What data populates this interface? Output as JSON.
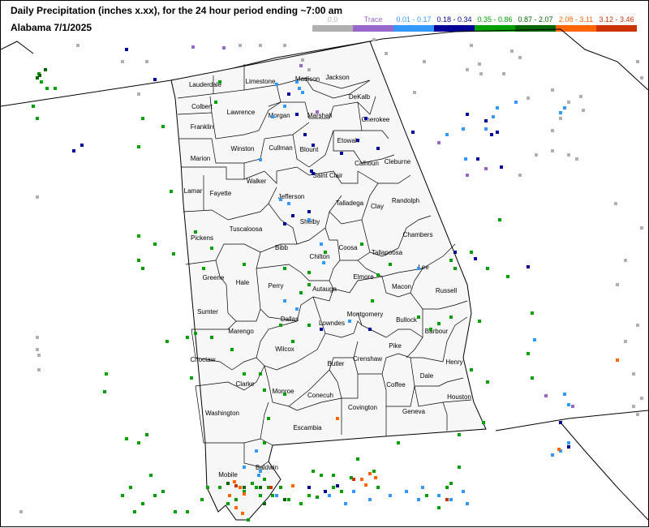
{
  "title": "Daily Precipitation (inches  x.xx),  for the 24 hour period ending ~7:00 am",
  "subtitle": "Alabama 7/1/2025",
  "legend": [
    {
      "label": "0.0",
      "color": "#b0b0b0"
    },
    {
      "label": "Trace",
      "color": "#9966cc"
    },
    {
      "label": "0.01 - 0.17",
      "color": "#3399ff"
    },
    {
      "label": "0.18 - 0.34",
      "color": "#000099"
    },
    {
      "label": "0.35 - 0.86",
      "color": "#00a000"
    },
    {
      "label": "0.87 - 2.07",
      "color": "#006600"
    },
    {
      "label": "2.08 - 3.11",
      "color": "#ff6600"
    },
    {
      "label": "3.12 - 3.46",
      "color": "#cc3300"
    }
  ],
  "counties": [
    "Lauderdale",
    "Limestone",
    "Madison",
    "Jackson",
    "Colbert",
    "Lawrence",
    "Morgan",
    "Marshall",
    "DeKalb",
    "Franklin",
    "Cherokee",
    "Winston",
    "Cullman",
    "Blount",
    "Etowah",
    "Marion",
    "Calhoun",
    "Cleburne",
    "Saint Clair",
    "Lamar",
    "Fayette",
    "Walker",
    "Jefferson",
    "Talladega",
    "Randolph",
    "Clay",
    "Shelby",
    "Tuscaloosa",
    "Pickens",
    "Bibb",
    "Chambers",
    "Coosa",
    "Tallapoosa",
    "Chilton",
    "Lee",
    "Greene",
    "Hale",
    "Elmore",
    "Perry",
    "Autauga",
    "Macon",
    "Russell",
    "Sumter",
    "Montgomery",
    "Dallas",
    "Bullock",
    "Lowndes",
    "Marengo",
    "Barbour",
    "Wilcox",
    "Choctaw",
    "Henry",
    "Crenshaw",
    "Butler",
    "Pike",
    "Clarke",
    "Dale",
    "Coffee",
    "Monroe",
    "Conecuh",
    "Houston",
    "Covington",
    "Washington",
    "Geneva",
    "Escambia",
    "Mobile",
    "Baldwin"
  ],
  "stations_by_class": [
    [
      [
        95,
        55
      ],
      [
        150,
        75
      ],
      [
        170,
        115
      ],
      [
        45,
        242
      ],
      [
        25,
        630
      ],
      [
        45,
        415
      ],
      [
        47,
        437
      ],
      [
        47,
        455
      ],
      [
        180,
        75
      ],
      [
        295,
        55
      ],
      [
        320,
        55
      ],
      [
        350,
        55
      ],
      [
        372,
        73
      ],
      [
        380,
        85
      ],
      [
        460,
        48
      ],
      [
        510,
        113
      ],
      [
        522,
        75
      ],
      [
        475,
        65
      ],
      [
        575,
        85
      ],
      [
        580,
        55
      ],
      [
        590,
        78
      ],
      [
        592,
        90
      ],
      [
        630,
        62
      ],
      [
        640,
        70
      ],
      [
        620,
        90
      ],
      [
        650,
        120
      ],
      [
        680,
        110
      ],
      [
        690,
        145
      ],
      [
        700,
        125
      ],
      [
        715,
        118
      ],
      [
        718,
        135
      ],
      [
        700,
        190
      ],
      [
        710,
        195
      ],
      [
        660,
        190
      ],
      [
        640,
        215
      ],
      [
        680,
        185
      ],
      [
        785,
        75
      ],
      [
        790,
        95
      ],
      [
        758,
        250
      ],
      [
        790,
        280
      ],
      [
        770,
        320
      ],
      [
        760,
        350
      ],
      [
        785,
        400
      ],
      [
        770,
        420
      ],
      [
        780,
        460
      ],
      [
        790,
        490
      ],
      [
        780,
        500
      ],
      [
        785,
        510
      ],
      [
        45,
        430
      ],
      [
        680,
        160
      ]
    ],
    [
      [
        237,
        57
      ],
      [
        275,
        58
      ],
      [
        370,
        80
      ],
      [
        390,
        137
      ],
      [
        540,
        175
      ],
      [
        575,
        215
      ],
      [
        598,
        207
      ],
      [
        672,
        487
      ],
      [
        705,
        500
      ]
    ],
    [
      [
        340,
        103
      ],
      [
        365,
        100
      ],
      [
        368,
        108
      ],
      [
        372,
        113
      ],
      [
        350,
        130
      ],
      [
        335,
        143
      ],
      [
        320,
        196
      ],
      [
        345,
        245
      ],
      [
        355,
        250
      ],
      [
        380,
        270
      ],
      [
        395,
        300
      ],
      [
        398,
        323
      ],
      [
        515,
        330
      ],
      [
        560,
        330
      ],
      [
        550,
        165
      ],
      [
        570,
        158
      ],
      [
        598,
        158
      ],
      [
        607,
        143
      ],
      [
        612,
        132
      ],
      [
        635,
        125
      ],
      [
        690,
        138
      ],
      [
        695,
        132
      ],
      [
        573,
        195
      ],
      [
        658,
        418
      ],
      [
        695,
        485
      ],
      [
        700,
        498
      ],
      [
        690,
        555
      ],
      [
        700,
        545
      ],
      [
        680,
        560
      ],
      [
        318,
        585
      ],
      [
        340,
        610
      ],
      [
        405,
        610
      ],
      [
        425,
        620
      ],
      [
        435,
        605
      ],
      [
        455,
        615
      ],
      [
        480,
        610
      ],
      [
        500,
        605
      ],
      [
        515,
        615
      ],
      [
        520,
        600
      ],
      [
        540,
        610
      ],
      [
        555,
        615
      ],
      [
        570,
        605
      ],
      [
        575,
        620
      ],
      [
        350,
        370
      ],
      [
        365,
        380
      ],
      [
        315,
        555
      ],
      [
        300,
        575
      ],
      [
        320,
        580
      ],
      [
        430,
        395
      ]
    ],
    [
      [
        90,
        185
      ],
      [
        100,
        178
      ],
      [
        155,
        60
      ],
      [
        190,
        97
      ],
      [
        355,
        115
      ],
      [
        365,
        140
      ],
      [
        375,
        165
      ],
      [
        385,
        178
      ],
      [
        383,
        210
      ],
      [
        385,
        213
      ],
      [
        360,
        265
      ],
      [
        380,
        260
      ],
      [
        350,
        275
      ],
      [
        420,
        188
      ],
      [
        440,
        172
      ],
      [
        450,
        145
      ],
      [
        465,
        182
      ],
      [
        508,
        162
      ],
      [
        575,
        140
      ],
      [
        598,
        148
      ],
      [
        605,
        165
      ],
      [
        612,
        162
      ],
      [
        588,
        195
      ],
      [
        617,
        205
      ],
      [
        560,
        310
      ],
      [
        585,
        318
      ],
      [
        650,
        328
      ],
      [
        690,
        520
      ],
      [
        700,
        550
      ],
      [
        395,
        405
      ],
      [
        455,
        405
      ],
      [
        380,
        600
      ],
      [
        400,
        605
      ],
      [
        415,
        598
      ]
    ],
    [
      [
        47,
        90
      ],
      [
        50,
        100
      ],
      [
        57,
        108
      ],
      [
        67,
        108
      ],
      [
        40,
        130
      ],
      [
        45,
        145
      ],
      [
        200,
        155
      ],
      [
        270,
        100
      ],
      [
        265,
        125
      ],
      [
        170,
        180
      ],
      [
        175,
        145
      ],
      [
        170,
        320
      ],
      [
        190,
        300
      ],
      [
        213,
        312
      ],
      [
        260,
        305
      ],
      [
        240,
        285
      ],
      [
        170,
        290
      ],
      [
        175,
        330
      ],
      [
        210,
        235
      ],
      [
        250,
        330
      ],
      [
        300,
        325
      ],
      [
        350,
        330
      ],
      [
        380,
        335
      ],
      [
        400,
        310
      ],
      [
        445,
        300
      ],
      [
        458,
        370
      ],
      [
        480,
        325
      ],
      [
        465,
        338
      ],
      [
        515,
        390
      ],
      [
        530,
        405
      ],
      [
        540,
        398
      ],
      [
        555,
        390
      ],
      [
        560,
        330
      ],
      [
        580,
        310
      ],
      [
        600,
        330
      ],
      [
        555,
        320
      ],
      [
        615,
        270
      ],
      [
        625,
        340
      ],
      [
        655,
        385
      ],
      [
        590,
        395
      ],
      [
        650,
        435
      ],
      [
        655,
        465
      ],
      [
        580,
        455
      ],
      [
        600,
        470
      ],
      [
        595,
        520
      ],
      [
        565,
        535
      ],
      [
        565,
        575
      ],
      [
        555,
        595
      ],
      [
        550,
        600
      ],
      [
        540,
        625
      ],
      [
        525,
        610
      ],
      [
        490,
        545
      ],
      [
        440,
        565
      ],
      [
        385,
        580
      ],
      [
        380,
        610
      ],
      [
        370,
        620
      ],
      [
        355,
        615
      ],
      [
        345,
        600
      ],
      [
        335,
        610
      ],
      [
        330,
        600
      ],
      [
        320,
        610
      ],
      [
        315,
        600
      ],
      [
        310,
        595
      ],
      [
        305,
        640
      ],
      [
        300,
        605
      ],
      [
        290,
        615
      ],
      [
        280,
        620
      ],
      [
        270,
        600
      ],
      [
        255,
        600
      ],
      [
        248,
        615
      ],
      [
        230,
        630
      ],
      [
        215,
        630
      ],
      [
        200,
        605
      ],
      [
        185,
        585
      ],
      [
        190,
        610
      ],
      [
        175,
        620
      ],
      [
        165,
        630
      ],
      [
        150,
        610
      ],
      [
        160,
        600
      ],
      [
        180,
        535
      ],
      [
        170,
        545
      ],
      [
        155,
        540
      ],
      [
        130,
        460
      ],
      [
        128,
        482
      ],
      [
        235,
        465
      ],
      [
        230,
        415
      ],
      [
        205,
        420
      ],
      [
        240,
        410
      ],
      [
        260,
        415
      ],
      [
        285,
        430
      ],
      [
        325,
        545
      ],
      [
        325,
        590
      ],
      [
        410,
        585
      ],
      [
        432,
        588
      ],
      [
        390,
        612
      ],
      [
        395,
        585
      ],
      [
        410,
        600
      ],
      [
        420,
        605
      ],
      [
        460,
        580
      ],
      [
        465,
        600
      ],
      [
        380,
        350
      ],
      [
        360,
        420
      ],
      [
        345,
        400
      ],
      [
        370,
        360
      ],
      [
        380,
        400
      ],
      [
        320,
        460
      ],
      [
        300,
        460
      ],
      [
        325,
        480
      ],
      [
        350,
        485
      ],
      [
        330,
        515
      ]
    ],
    [
      [
        45,
        95
      ],
      [
        48,
        92
      ],
      [
        55,
        85
      ],
      [
        350,
        615
      ],
      [
        300,
        600
      ],
      [
        320,
        600
      ],
      [
        325,
        620
      ],
      [
        280,
        595
      ]
    ],
    [
      [
        288,
        593
      ],
      [
        295,
        600
      ],
      [
        282,
        610
      ],
      [
        290,
        625
      ],
      [
        298,
        632
      ],
      [
        300,
        608
      ],
      [
        360,
        598
      ],
      [
        445,
        590
      ],
      [
        450,
        597
      ],
      [
        455,
        583
      ],
      [
        462,
        588
      ],
      [
        415,
        515
      ],
      [
        760,
        443
      ],
      [
        688,
        553
      ]
    ],
    [
      [
        435,
        590
      ],
      [
        333,
        600
      ],
      [
        290,
        598
      ],
      [
        550,
        615
      ]
    ]
  ]
}
